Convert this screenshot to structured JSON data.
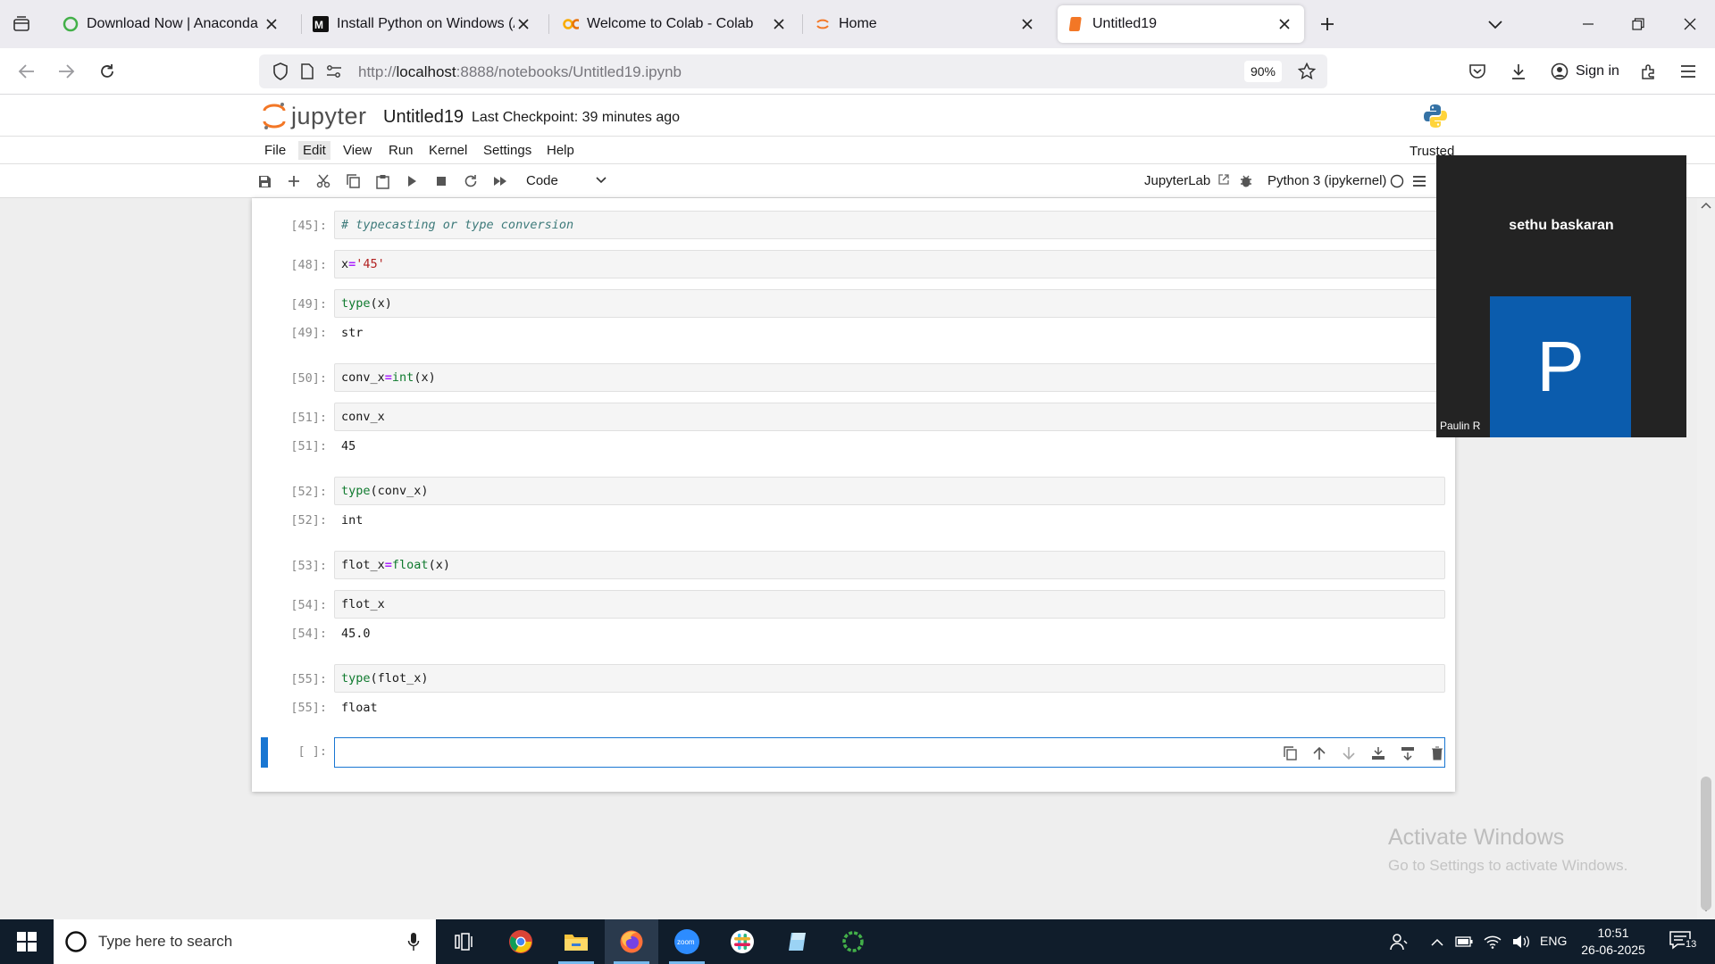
{
  "browser": {
    "tabs": [
      {
        "title": "Download Now | Anaconda",
        "icon": "anaconda-ring-icon"
      },
      {
        "title": "Install Python on Windows (Ana",
        "icon": "medium-logo-icon"
      },
      {
        "title": "Welcome to Colab - Colab",
        "icon": "colab-logo-icon"
      },
      {
        "title": "Home",
        "icon": "jupyter-spinner-icon"
      },
      {
        "title": "Untitled19",
        "icon": "notebook-icon",
        "active": true
      }
    ],
    "url_prefix": "http://",
    "url_host": "localhost",
    "url_rest": ":8888/notebooks/Untitled19.ipynb",
    "zoom": "90%",
    "sign_in": "Sign in"
  },
  "jupyter": {
    "logo_text": "jupyter",
    "notebook_name": "Untitled19",
    "checkpoint": "Last Checkpoint: 39 minutes ago",
    "menu": [
      "File",
      "Edit",
      "View",
      "Run",
      "Kernel",
      "Settings",
      "Help"
    ],
    "trusted": "Trusted",
    "cell_type": "Code",
    "jupyterlab_link": "JupyterLab",
    "kernel": "Python 3 (ipykernel)"
  },
  "cells": [
    {
      "prompt": "[45]:",
      "tokens": [
        {
          "t": "# typecasting or type conversion",
          "c": "cm"
        }
      ]
    },
    {
      "prompt": "[48]:",
      "tokens": [
        {
          "t": "x",
          "c": ""
        },
        {
          "t": "=",
          "c": "op"
        },
        {
          "t": "'45'",
          "c": "st"
        }
      ]
    },
    {
      "prompt": "[49]:",
      "tokens": [
        {
          "t": "type",
          "c": "bi"
        },
        {
          "t": "(x)",
          "c": ""
        }
      ],
      "out_prompt": "[49]:",
      "out": "str"
    },
    {
      "prompt": "[50]:",
      "tokens": [
        {
          "t": "conv_x",
          "c": ""
        },
        {
          "t": "=",
          "c": "op"
        },
        {
          "t": "int",
          "c": "bi"
        },
        {
          "t": "(x)",
          "c": ""
        }
      ]
    },
    {
      "prompt": "[51]:",
      "tokens": [
        {
          "t": "conv_x",
          "c": ""
        }
      ],
      "out_prompt": "[51]:",
      "out": "45"
    },
    {
      "prompt": "[52]:",
      "tokens": [
        {
          "t": "type",
          "c": "bi"
        },
        {
          "t": "(conv_x)",
          "c": ""
        }
      ],
      "out_prompt": "[52]:",
      "out": "int"
    },
    {
      "prompt": "[53]:",
      "tokens": [
        {
          "t": "flot_x",
          "c": ""
        },
        {
          "t": "=",
          "c": "op"
        },
        {
          "t": "float",
          "c": "bi"
        },
        {
          "t": "(x)",
          "c": ""
        }
      ]
    },
    {
      "prompt": "[54]:",
      "tokens": [
        {
          "t": "flot_x",
          "c": ""
        }
      ],
      "out_prompt": "[54]:",
      "out": "45.0"
    },
    {
      "prompt": "[55]:",
      "tokens": [
        {
          "t": "type",
          "c": "bi"
        },
        {
          "t": "(flot_x)",
          "c": ""
        }
      ],
      "out_prompt": "[55]:",
      "out": "float"
    }
  ],
  "active_cell": {
    "prompt": "[ ]:",
    "value": ""
  },
  "watermark": {
    "line1": "Activate Windows",
    "line2": "Go to Settings to activate Windows."
  },
  "video": {
    "name": "sethu baskaran",
    "avatar_letter": "P",
    "label": "Paulin R"
  },
  "taskbar": {
    "search_placeholder": "Type here to search",
    "language": "ENG",
    "time": "10:51",
    "date": "26-06-2025",
    "notification_count": "13"
  },
  "colors": {
    "accent": "#1976d2",
    "taskbar": "#101d2b",
    "avatar": "#0b5cad"
  }
}
